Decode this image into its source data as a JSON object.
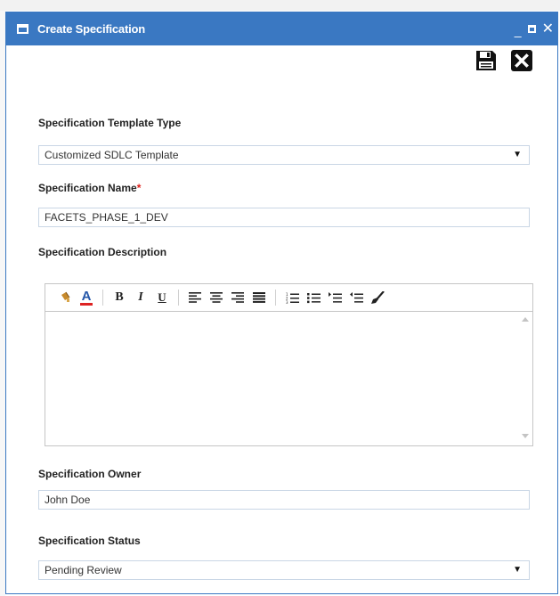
{
  "dialog": {
    "title": "Create Specification",
    "controls": {
      "minimize": "_",
      "close": "✕"
    }
  },
  "fields": {
    "template_type": {
      "label": "Specification Template Type",
      "value": "Customized SDLC Template"
    },
    "name": {
      "label": "Specification Name",
      "required_mark": "*",
      "value": "FACETS_PHASE_1_DEV"
    },
    "description": {
      "label": "Specification Description",
      "value": ""
    },
    "owner": {
      "label": "Specification Owner",
      "value": "John Doe"
    },
    "status": {
      "label": "Specification Status",
      "value": "Pending Review"
    }
  },
  "editor_toolbar": {
    "bold": "B",
    "italic": "I",
    "underline": "U",
    "font_color": "A"
  },
  "icons": {
    "actions": [
      "save-icon",
      "close-icon"
    ],
    "toolbar": [
      "paint-bucket-icon",
      "font-color-icon",
      "bold-icon",
      "italic-icon",
      "underline-icon",
      "align-left-icon",
      "align-center-icon",
      "align-right-icon",
      "align-justify-icon",
      "numbered-list-icon",
      "bulleted-list-icon",
      "indent-icon",
      "outdent-icon",
      "clear-format-icon"
    ]
  },
  "colors": {
    "titlebar": "#3a78c2",
    "required": "#e0201a",
    "field_border": "#c9d6e5"
  }
}
